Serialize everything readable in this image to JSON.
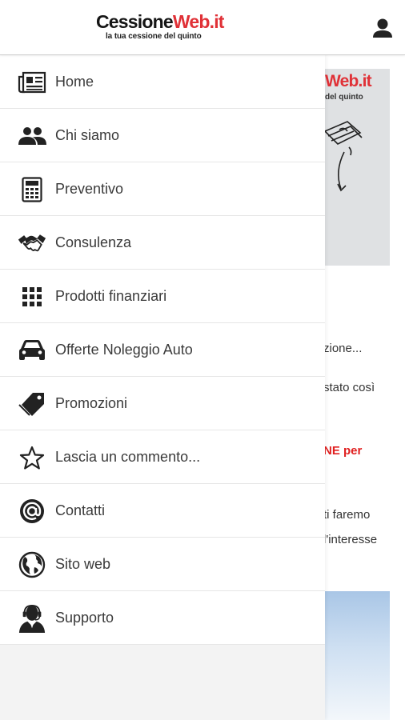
{
  "header": {
    "logo": {
      "name_part1": "Cessione",
      "name_part2": "Web.it",
      "tagline": "la tua cessione del quinto"
    },
    "user_icon": "user-icon"
  },
  "menu": {
    "items": [
      {
        "label": "Home",
        "icon": "newspaper-icon"
      },
      {
        "label": "Chi siamo",
        "icon": "people-icon"
      },
      {
        "label": "Preventivo",
        "icon": "calculator-icon"
      },
      {
        "label": "Consulenza",
        "icon": "handshake-icon"
      },
      {
        "label": "Prodotti finanziari",
        "icon": "grid-icon"
      },
      {
        "label": "Offerte Noleggio Auto",
        "icon": "car-icon"
      },
      {
        "label": "Promozioni",
        "icon": "tags-icon"
      },
      {
        "label": "Lascia un commento...",
        "icon": "star-icon"
      },
      {
        "label": "Contatti",
        "icon": "at-icon"
      },
      {
        "label": "Sito web",
        "icon": "globe-icon"
      },
      {
        "label": "Supporto",
        "icon": "support-agent-icon"
      }
    ]
  },
  "background": {
    "banner_title": "Web.it",
    "banner_sub": "del quinto",
    "text_1": "zione...",
    "text_2": "stato così",
    "text_3": "NE per",
    "text_4": "ti faremo",
    "text_5": "l'interesse"
  },
  "colors": {
    "brand_red": "#e03137",
    "text_dark": "#3a3a3a",
    "drawer_bg": "#f3f3f3"
  }
}
